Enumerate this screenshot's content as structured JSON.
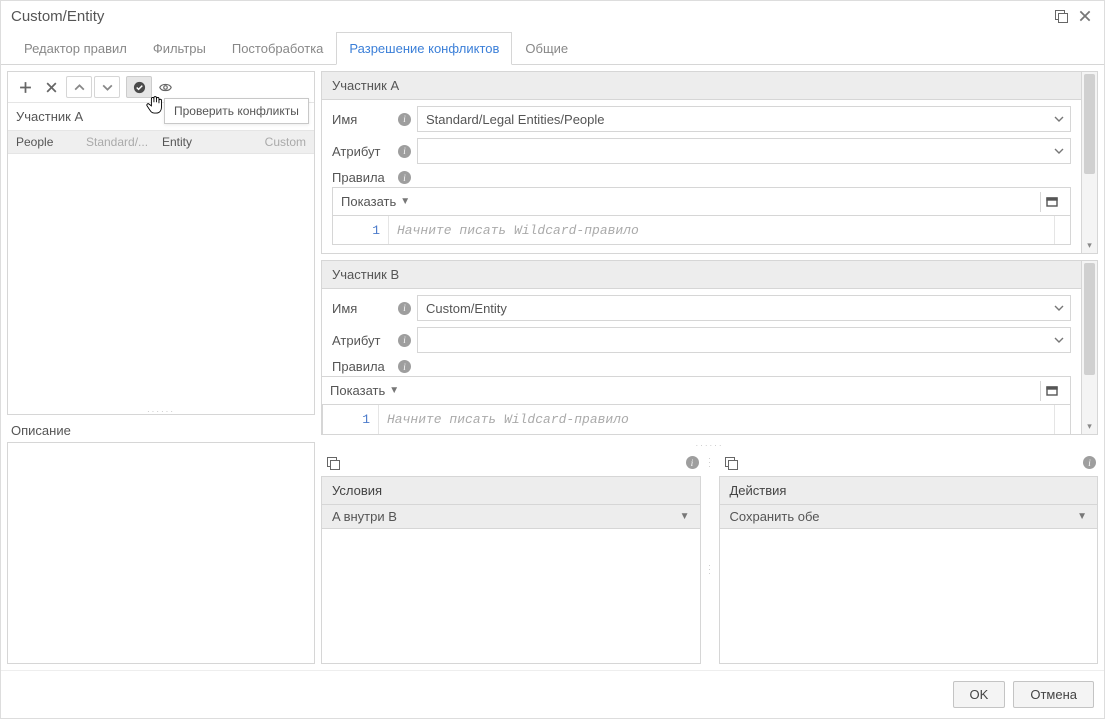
{
  "titlebar": {
    "title": "Custom/Entity"
  },
  "tabs": [
    {
      "label": "Редактор правил",
      "active": false
    },
    {
      "label": "Фильтры",
      "active": false
    },
    {
      "label": "Постобработка",
      "active": false
    },
    {
      "label": "Разрешение конфликтов",
      "active": true
    },
    {
      "label": "Общие",
      "active": false
    }
  ],
  "left_panel": {
    "tooltip": "Проверить конфликты",
    "header": "Участник A",
    "row": {
      "c1": "People",
      "c2": "Standard/...",
      "c3": "Entity",
      "c4": "Custom"
    },
    "description_label": "Описание"
  },
  "participantA": {
    "title": "Участник A",
    "name_label": "Имя",
    "attr_label": "Атрибут",
    "rules_label": "Правила",
    "name_value": "Standard/Legal Entities/People",
    "attr_value": "",
    "show_label": "Показать",
    "line_no": "1",
    "placeholder": "Начните писать Wildcard-правило"
  },
  "participantB": {
    "title": "Участник B",
    "name_label": "Имя",
    "attr_label": "Атрибут",
    "rules_label": "Правила",
    "name_value": "Custom/Entity",
    "attr_value": "",
    "show_label": "Показать",
    "line_no": "1",
    "placeholder": "Начните писать Wildcard-правило"
  },
  "conditions": {
    "title": "Условия",
    "value": "A внутри B"
  },
  "actions": {
    "title": "Действия",
    "value": "Сохранить обе"
  },
  "footer": {
    "ok": "OK",
    "cancel": "Отмена"
  }
}
